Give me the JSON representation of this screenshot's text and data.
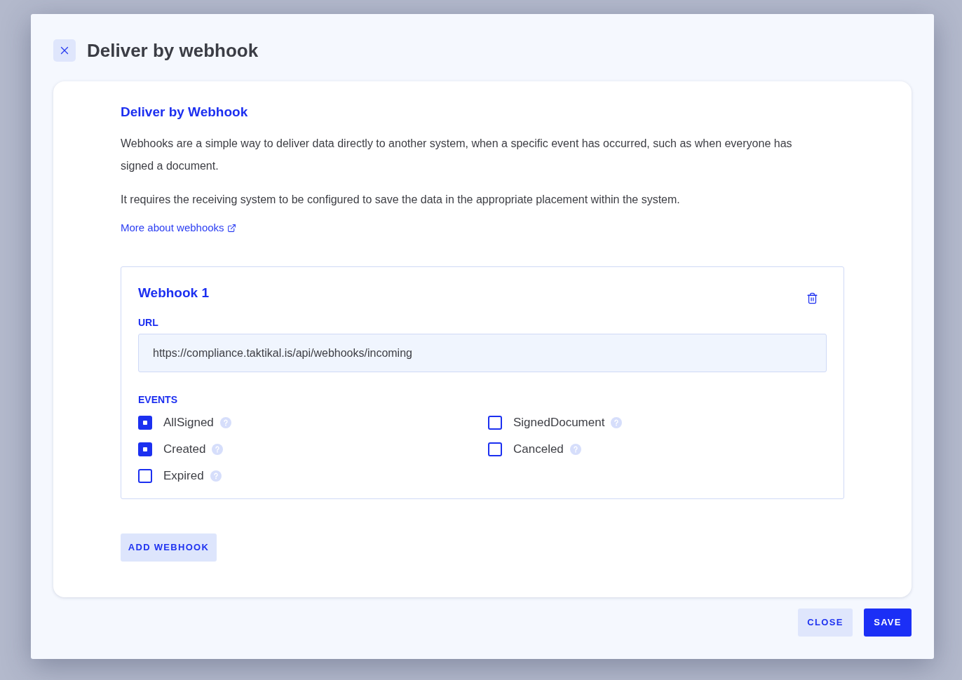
{
  "dialog": {
    "title": "Deliver by webhook"
  },
  "intro": {
    "heading": "Deliver by Webhook",
    "paragraphs": [
      "Webhooks are a simple way to deliver data directly to another system, when a specific event has occurred, such as when everyone has signed a document.",
      "It requires the receiving system to be configured to save the data in the appropriate placement within the system."
    ],
    "link": "More about webhooks"
  },
  "webhooks": [
    {
      "title": "Webhook 1",
      "url_label": "URL",
      "url": "https://compliance.taktikal.is/api/webhooks/incoming",
      "events_label": "EVENTS",
      "events": [
        {
          "label": "AllSigned",
          "checked": true
        },
        {
          "label": "Created",
          "checked": true
        },
        {
          "label": "Expired",
          "checked": false
        },
        {
          "label": "SignedDocument",
          "checked": false
        },
        {
          "label": "Canceled",
          "checked": false
        }
      ]
    }
  ],
  "add_button": "ADD WEBHOOK",
  "footer_buttons": [
    {
      "label": "CLOSE",
      "kind": "secondary"
    },
    {
      "label": "SAVE",
      "kind": "primary"
    }
  ]
}
